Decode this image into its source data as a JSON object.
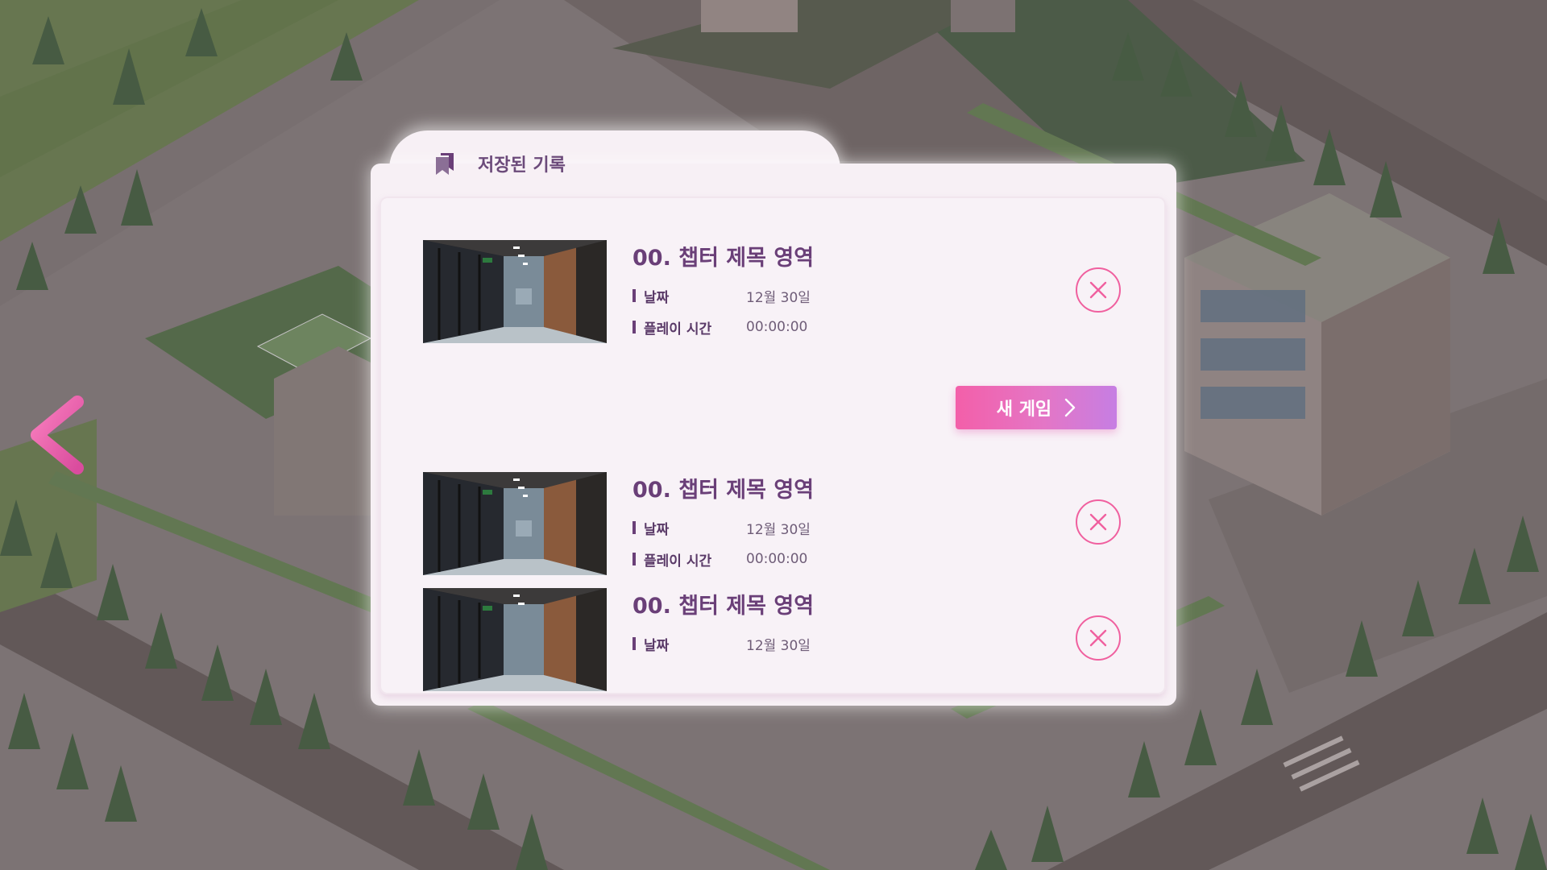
{
  "panel": {
    "title": "저장된 기록",
    "title_icon": "bookmark-stack-icon"
  },
  "back_button": {
    "icon": "chevron-left-icon"
  },
  "new_game": {
    "label": "새 게임",
    "icon": "chevron-right-icon"
  },
  "slots": [
    {
      "title": "00. 챕터 제목 영역",
      "date_label": "날짜",
      "date_value": "12월 30일",
      "playtime_label": "플레이 시간",
      "playtime_value": "00:00:00"
    },
    {
      "title": "00. 챕터 제목 영역",
      "date_label": "날짜",
      "date_value": "12월 30일",
      "playtime_label": "플레이 시간",
      "playtime_value": "00:00:00"
    },
    {
      "title": "00. 챕터 제목 영역",
      "date_label": "날짜",
      "date_value": "12월 30일"
    }
  ],
  "colors": {
    "accent_pink": "#f0609f",
    "title_purple": "#6a3f78",
    "panel_bg": "#f7f0f5",
    "button_gradient_start": "#f35fa9",
    "button_gradient_end": "#c67ee3"
  }
}
